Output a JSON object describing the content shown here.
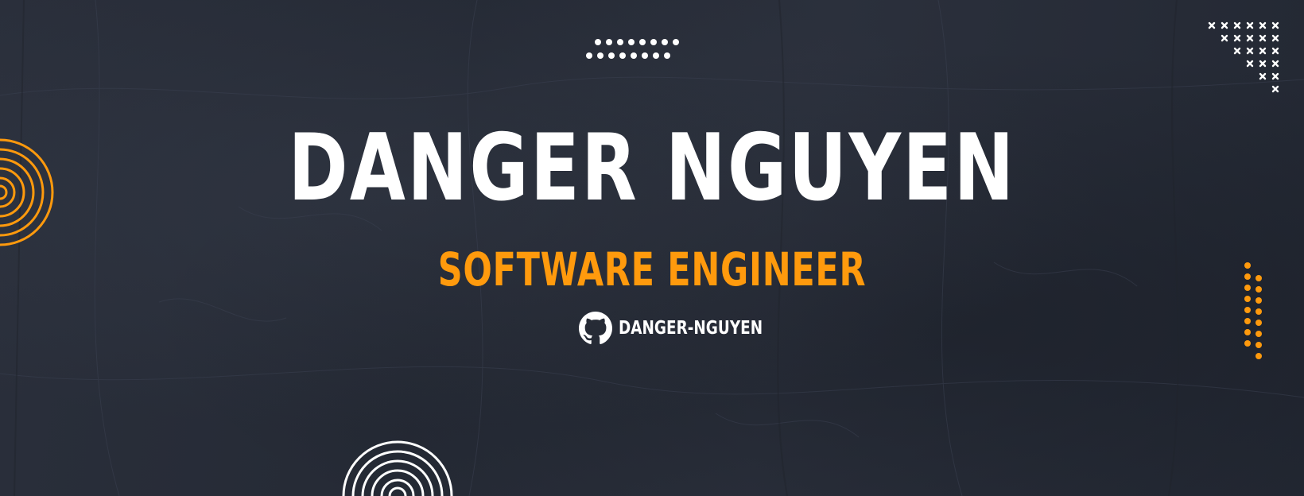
{
  "banner": {
    "name": "DANGER NGUYEN",
    "title": "SOFTWARE ENGINEER",
    "github_handle": "DANGER-NGUYEN",
    "github_icon": "github-icon"
  },
  "colors": {
    "background": "#272c38",
    "name_text": "#ffffff",
    "accent": "#ff9a0d",
    "handle_text": "#ffffff"
  },
  "decorations": {
    "top_dot_grid": "white-dot-grid",
    "top_right_cross_grid": "white-cross-grid",
    "left_spiral": "orange-spiral",
    "bottom_spiral": "white-spiral",
    "right_dot_column": "orange-dot-column"
  }
}
